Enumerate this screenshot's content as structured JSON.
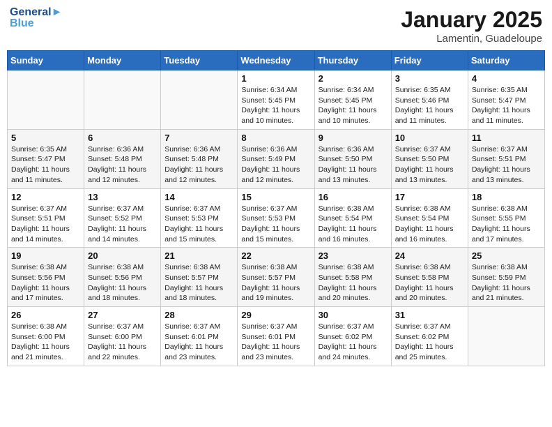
{
  "logo": {
    "line1": "General",
    "line2": "Blue"
  },
  "title": "January 2025",
  "location": "Lamentin, Guadeloupe",
  "days_of_week": [
    "Sunday",
    "Monday",
    "Tuesday",
    "Wednesday",
    "Thursday",
    "Friday",
    "Saturday"
  ],
  "weeks": [
    [
      {
        "day": "",
        "info": ""
      },
      {
        "day": "",
        "info": ""
      },
      {
        "day": "",
        "info": ""
      },
      {
        "day": "1",
        "info": "Sunrise: 6:34 AM\nSunset: 5:45 PM\nDaylight: 11 hours\nand 10 minutes."
      },
      {
        "day": "2",
        "info": "Sunrise: 6:34 AM\nSunset: 5:45 PM\nDaylight: 11 hours\nand 10 minutes."
      },
      {
        "day": "3",
        "info": "Sunrise: 6:35 AM\nSunset: 5:46 PM\nDaylight: 11 hours\nand 11 minutes."
      },
      {
        "day": "4",
        "info": "Sunrise: 6:35 AM\nSunset: 5:47 PM\nDaylight: 11 hours\nand 11 minutes."
      }
    ],
    [
      {
        "day": "5",
        "info": "Sunrise: 6:35 AM\nSunset: 5:47 PM\nDaylight: 11 hours\nand 11 minutes."
      },
      {
        "day": "6",
        "info": "Sunrise: 6:36 AM\nSunset: 5:48 PM\nDaylight: 11 hours\nand 12 minutes."
      },
      {
        "day": "7",
        "info": "Sunrise: 6:36 AM\nSunset: 5:48 PM\nDaylight: 11 hours\nand 12 minutes."
      },
      {
        "day": "8",
        "info": "Sunrise: 6:36 AM\nSunset: 5:49 PM\nDaylight: 11 hours\nand 12 minutes."
      },
      {
        "day": "9",
        "info": "Sunrise: 6:36 AM\nSunset: 5:50 PM\nDaylight: 11 hours\nand 13 minutes."
      },
      {
        "day": "10",
        "info": "Sunrise: 6:37 AM\nSunset: 5:50 PM\nDaylight: 11 hours\nand 13 minutes."
      },
      {
        "day": "11",
        "info": "Sunrise: 6:37 AM\nSunset: 5:51 PM\nDaylight: 11 hours\nand 13 minutes."
      }
    ],
    [
      {
        "day": "12",
        "info": "Sunrise: 6:37 AM\nSunset: 5:51 PM\nDaylight: 11 hours\nand 14 minutes."
      },
      {
        "day": "13",
        "info": "Sunrise: 6:37 AM\nSunset: 5:52 PM\nDaylight: 11 hours\nand 14 minutes."
      },
      {
        "day": "14",
        "info": "Sunrise: 6:37 AM\nSunset: 5:53 PM\nDaylight: 11 hours\nand 15 minutes."
      },
      {
        "day": "15",
        "info": "Sunrise: 6:37 AM\nSunset: 5:53 PM\nDaylight: 11 hours\nand 15 minutes."
      },
      {
        "day": "16",
        "info": "Sunrise: 6:38 AM\nSunset: 5:54 PM\nDaylight: 11 hours\nand 16 minutes."
      },
      {
        "day": "17",
        "info": "Sunrise: 6:38 AM\nSunset: 5:54 PM\nDaylight: 11 hours\nand 16 minutes."
      },
      {
        "day": "18",
        "info": "Sunrise: 6:38 AM\nSunset: 5:55 PM\nDaylight: 11 hours\nand 17 minutes."
      }
    ],
    [
      {
        "day": "19",
        "info": "Sunrise: 6:38 AM\nSunset: 5:56 PM\nDaylight: 11 hours\nand 17 minutes."
      },
      {
        "day": "20",
        "info": "Sunrise: 6:38 AM\nSunset: 5:56 PM\nDaylight: 11 hours\nand 18 minutes."
      },
      {
        "day": "21",
        "info": "Sunrise: 6:38 AM\nSunset: 5:57 PM\nDaylight: 11 hours\nand 18 minutes."
      },
      {
        "day": "22",
        "info": "Sunrise: 6:38 AM\nSunset: 5:57 PM\nDaylight: 11 hours\nand 19 minutes."
      },
      {
        "day": "23",
        "info": "Sunrise: 6:38 AM\nSunset: 5:58 PM\nDaylight: 11 hours\nand 20 minutes."
      },
      {
        "day": "24",
        "info": "Sunrise: 6:38 AM\nSunset: 5:58 PM\nDaylight: 11 hours\nand 20 minutes."
      },
      {
        "day": "25",
        "info": "Sunrise: 6:38 AM\nSunset: 5:59 PM\nDaylight: 11 hours\nand 21 minutes."
      }
    ],
    [
      {
        "day": "26",
        "info": "Sunrise: 6:38 AM\nSunset: 6:00 PM\nDaylight: 11 hours\nand 21 minutes."
      },
      {
        "day": "27",
        "info": "Sunrise: 6:37 AM\nSunset: 6:00 PM\nDaylight: 11 hours\nand 22 minutes."
      },
      {
        "day": "28",
        "info": "Sunrise: 6:37 AM\nSunset: 6:01 PM\nDaylight: 11 hours\nand 23 minutes."
      },
      {
        "day": "29",
        "info": "Sunrise: 6:37 AM\nSunset: 6:01 PM\nDaylight: 11 hours\nand 23 minutes."
      },
      {
        "day": "30",
        "info": "Sunrise: 6:37 AM\nSunset: 6:02 PM\nDaylight: 11 hours\nand 24 minutes."
      },
      {
        "day": "31",
        "info": "Sunrise: 6:37 AM\nSunset: 6:02 PM\nDaylight: 11 hours\nand 25 minutes."
      },
      {
        "day": "",
        "info": ""
      }
    ]
  ]
}
